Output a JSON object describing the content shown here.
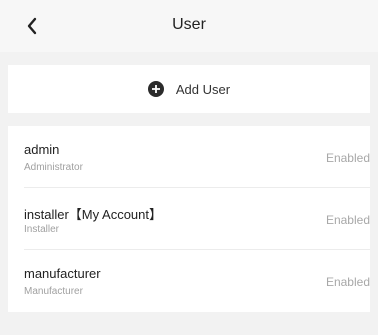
{
  "header": {
    "title": "User",
    "back_icon": "chevron-left-icon"
  },
  "add_user": {
    "label": "Add User",
    "icon": "plus-circle-icon"
  },
  "users": [
    {
      "name": "admin",
      "role": "Administrator",
      "status": "Enabled"
    },
    {
      "name": "installer【My Account】",
      "role": "Installer",
      "status": "Enabled"
    },
    {
      "name": "manufacturer",
      "role": "Manufacturer",
      "status": "Enabled"
    }
  ],
  "colors": {
    "background": "#f2f2f2",
    "card": "#ffffff",
    "secondary_text": "#a0a0a0"
  }
}
